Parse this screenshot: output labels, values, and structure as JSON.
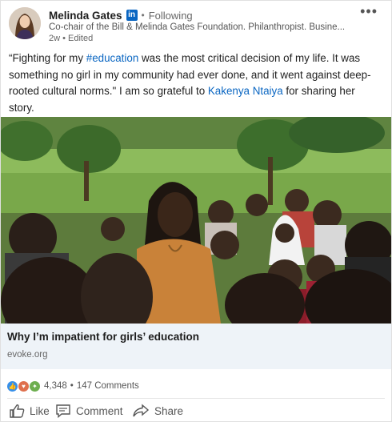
{
  "author": {
    "name": "Melinda Gates",
    "badge": "in",
    "separator": "•",
    "follow_status": "Following",
    "headline": "Co-chair of the Bill & Melinda Gates Foundation. Philanthropist. Busine...",
    "meta": "2w • Edited",
    "avatar_icon": "profile-photo"
  },
  "menu": {
    "more_label": "•••"
  },
  "post": {
    "text_1": "“Fighting for my ",
    "hashtag": "#education",
    "text_2": " was the most critical decision of my life. It was something no girl in my community had ever done, and it went against deep-rooted cultural norms.\" I am so grateful to ",
    "mention": "Kakenya Ntaiya",
    "text_3": " for sharing her story."
  },
  "link_preview": {
    "title": "Why I’m impatient for girls’ education",
    "source": "evoke.org"
  },
  "social": {
    "reaction_icons": [
      "like-icon",
      "love-icon",
      "celebrate-icon"
    ],
    "reaction_count": "4,348",
    "separator": "•",
    "comments": "147 Comments"
  },
  "actions": {
    "like": "Like",
    "comment": "Comment",
    "share": "Share"
  },
  "colors": {
    "accent": "#0a66c2",
    "preview_bg": "#eef3f8",
    "like": "#378fe9",
    "love": "#df704d",
    "celebrate": "#6dae4f"
  }
}
